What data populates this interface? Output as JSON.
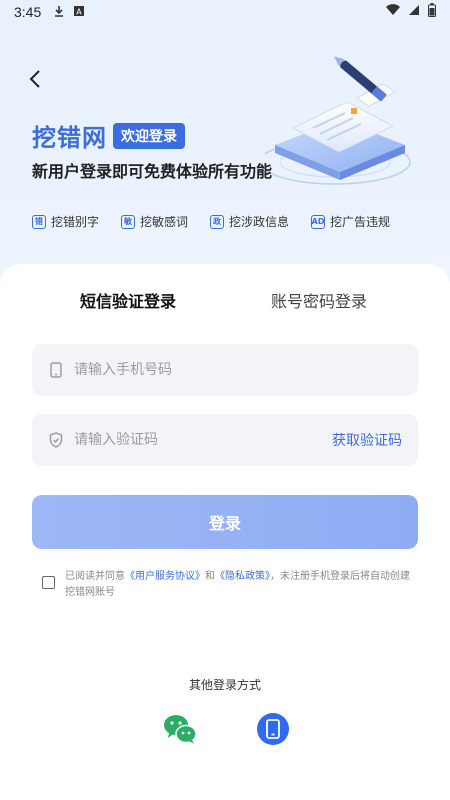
{
  "status_bar": {
    "time": "3:45",
    "left_icons": [
      "download-icon",
      "a-badge-icon"
    ],
    "right_icons": [
      "wifi-icon",
      "signal-icon",
      "battery-icon"
    ]
  },
  "header": {
    "brand_name": "挖错网",
    "badge": "欢迎登录",
    "subtitle": "新用户登录即可免费体验所有功能",
    "features": [
      {
        "icon_text": "错",
        "label": "挖错别字"
      },
      {
        "icon_text": "敏",
        "label": "挖敏感词"
      },
      {
        "icon_text": "政",
        "label": "挖涉政信息"
      },
      {
        "icon_text": "AD",
        "label": "挖广告违规"
      }
    ]
  },
  "tabs": {
    "sms": "短信验证登录",
    "account": "账号密码登录",
    "active": "sms"
  },
  "form": {
    "phone_placeholder": "请输入手机号码",
    "code_placeholder": "请输入验证码",
    "get_code": "获取验证码",
    "login": "登录"
  },
  "agreement": {
    "prefix": "已阅读并同意",
    "terms": "《用户服务协议》",
    "and": "和",
    "privacy": "《隐私政策》",
    "suffix": "，未注册手机登录后将自动创建挖错网账号"
  },
  "other_login": {
    "title": "其他登录方式",
    "methods": [
      "wechat-icon",
      "phone-icon"
    ]
  },
  "colors": {
    "primary": "#3c6ddd",
    "button": "#9db8f6",
    "phone_circle": "#2f6af0",
    "wechat": "#2aae67"
  }
}
